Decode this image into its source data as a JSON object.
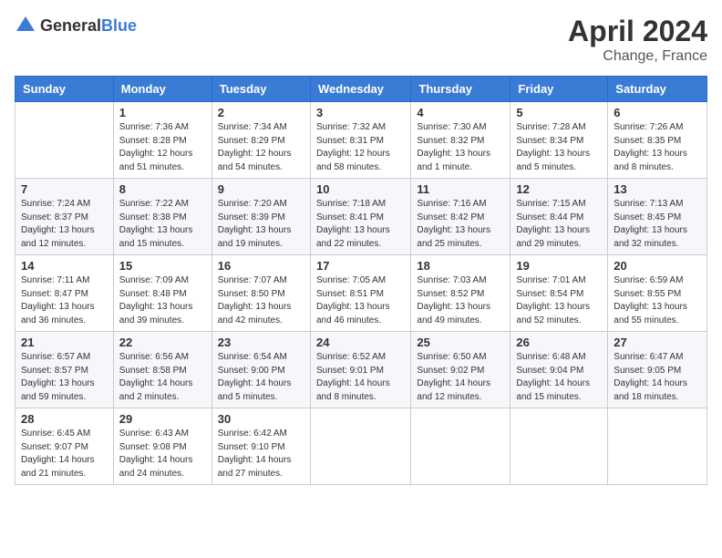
{
  "header": {
    "logo_general": "General",
    "logo_blue": "Blue",
    "month": "April 2024",
    "location": "Change, France"
  },
  "days_of_week": [
    "Sunday",
    "Monday",
    "Tuesday",
    "Wednesday",
    "Thursday",
    "Friday",
    "Saturday"
  ],
  "weeks": [
    [
      {
        "day": "",
        "info": ""
      },
      {
        "day": "1",
        "info": "Sunrise: 7:36 AM\nSunset: 8:28 PM\nDaylight: 12 hours\nand 51 minutes."
      },
      {
        "day": "2",
        "info": "Sunrise: 7:34 AM\nSunset: 8:29 PM\nDaylight: 12 hours\nand 54 minutes."
      },
      {
        "day": "3",
        "info": "Sunrise: 7:32 AM\nSunset: 8:31 PM\nDaylight: 12 hours\nand 58 minutes."
      },
      {
        "day": "4",
        "info": "Sunrise: 7:30 AM\nSunset: 8:32 PM\nDaylight: 13 hours\nand 1 minute."
      },
      {
        "day": "5",
        "info": "Sunrise: 7:28 AM\nSunset: 8:34 PM\nDaylight: 13 hours\nand 5 minutes."
      },
      {
        "day": "6",
        "info": "Sunrise: 7:26 AM\nSunset: 8:35 PM\nDaylight: 13 hours\nand 8 minutes."
      }
    ],
    [
      {
        "day": "7",
        "info": "Sunrise: 7:24 AM\nSunset: 8:37 PM\nDaylight: 13 hours\nand 12 minutes."
      },
      {
        "day": "8",
        "info": "Sunrise: 7:22 AM\nSunset: 8:38 PM\nDaylight: 13 hours\nand 15 minutes."
      },
      {
        "day": "9",
        "info": "Sunrise: 7:20 AM\nSunset: 8:39 PM\nDaylight: 13 hours\nand 19 minutes."
      },
      {
        "day": "10",
        "info": "Sunrise: 7:18 AM\nSunset: 8:41 PM\nDaylight: 13 hours\nand 22 minutes."
      },
      {
        "day": "11",
        "info": "Sunrise: 7:16 AM\nSunset: 8:42 PM\nDaylight: 13 hours\nand 25 minutes."
      },
      {
        "day": "12",
        "info": "Sunrise: 7:15 AM\nSunset: 8:44 PM\nDaylight: 13 hours\nand 29 minutes."
      },
      {
        "day": "13",
        "info": "Sunrise: 7:13 AM\nSunset: 8:45 PM\nDaylight: 13 hours\nand 32 minutes."
      }
    ],
    [
      {
        "day": "14",
        "info": "Sunrise: 7:11 AM\nSunset: 8:47 PM\nDaylight: 13 hours\nand 36 minutes."
      },
      {
        "day": "15",
        "info": "Sunrise: 7:09 AM\nSunset: 8:48 PM\nDaylight: 13 hours\nand 39 minutes."
      },
      {
        "day": "16",
        "info": "Sunrise: 7:07 AM\nSunset: 8:50 PM\nDaylight: 13 hours\nand 42 minutes."
      },
      {
        "day": "17",
        "info": "Sunrise: 7:05 AM\nSunset: 8:51 PM\nDaylight: 13 hours\nand 46 minutes."
      },
      {
        "day": "18",
        "info": "Sunrise: 7:03 AM\nSunset: 8:52 PM\nDaylight: 13 hours\nand 49 minutes."
      },
      {
        "day": "19",
        "info": "Sunrise: 7:01 AM\nSunset: 8:54 PM\nDaylight: 13 hours\nand 52 minutes."
      },
      {
        "day": "20",
        "info": "Sunrise: 6:59 AM\nSunset: 8:55 PM\nDaylight: 13 hours\nand 55 minutes."
      }
    ],
    [
      {
        "day": "21",
        "info": "Sunrise: 6:57 AM\nSunset: 8:57 PM\nDaylight: 13 hours\nand 59 minutes."
      },
      {
        "day": "22",
        "info": "Sunrise: 6:56 AM\nSunset: 8:58 PM\nDaylight: 14 hours\nand 2 minutes."
      },
      {
        "day": "23",
        "info": "Sunrise: 6:54 AM\nSunset: 9:00 PM\nDaylight: 14 hours\nand 5 minutes."
      },
      {
        "day": "24",
        "info": "Sunrise: 6:52 AM\nSunset: 9:01 PM\nDaylight: 14 hours\nand 8 minutes."
      },
      {
        "day": "25",
        "info": "Sunrise: 6:50 AM\nSunset: 9:02 PM\nDaylight: 14 hours\nand 12 minutes."
      },
      {
        "day": "26",
        "info": "Sunrise: 6:48 AM\nSunset: 9:04 PM\nDaylight: 14 hours\nand 15 minutes."
      },
      {
        "day": "27",
        "info": "Sunrise: 6:47 AM\nSunset: 9:05 PM\nDaylight: 14 hours\nand 18 minutes."
      }
    ],
    [
      {
        "day": "28",
        "info": "Sunrise: 6:45 AM\nSunset: 9:07 PM\nDaylight: 14 hours\nand 21 minutes."
      },
      {
        "day": "29",
        "info": "Sunrise: 6:43 AM\nSunset: 9:08 PM\nDaylight: 14 hours\nand 24 minutes."
      },
      {
        "day": "30",
        "info": "Sunrise: 6:42 AM\nSunset: 9:10 PM\nDaylight: 14 hours\nand 27 minutes."
      },
      {
        "day": "",
        "info": ""
      },
      {
        "day": "",
        "info": ""
      },
      {
        "day": "",
        "info": ""
      },
      {
        "day": "",
        "info": ""
      }
    ]
  ]
}
